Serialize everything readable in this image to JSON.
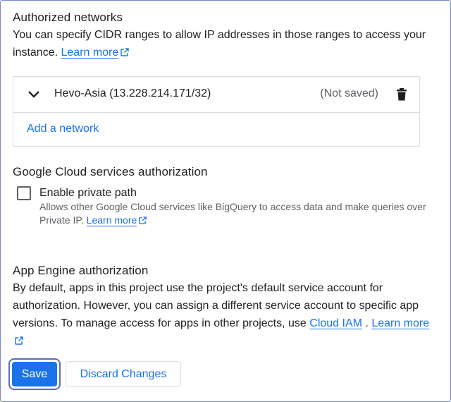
{
  "authorized_networks": {
    "title": "Authorized networks",
    "description": "You can specify CIDR ranges to allow IP addresses in those ranges to access your instance.",
    "learn_more": "Learn more",
    "networks": [
      {
        "name": "Hevo-Asia (13.228.214.171/32)",
        "status": "(Not saved)"
      }
    ],
    "add_network_label": "Add a network"
  },
  "gcs_authorization": {
    "title": "Google Cloud services authorization",
    "checkbox_label": "Enable private path",
    "checkbox_checked": false,
    "help_text": "Allows other Google Cloud services like BigQuery to access data and make queries over Private IP.",
    "learn_more": "Learn more"
  },
  "app_engine": {
    "title": "App Engine authorization",
    "description": "By default, apps in this project use the project's default service account for authorization. However, you can assign a different service account to specific app versions. To manage access for apps in other projects, use",
    "cloud_iam_link": "Cloud IAM",
    "separator": ".",
    "learn_more": "Learn more"
  },
  "actions": {
    "save_label": "Save",
    "discard_label": "Discard Changes"
  },
  "colors": {
    "accent": "#1a73e8",
    "focus_ring": "#5c6bc0",
    "border": "#dadce0",
    "secondary_text": "#5f6368"
  },
  "icons": {
    "external_link": "external-link-icon",
    "expand": "chevron-down-icon",
    "delete": "trash-icon"
  }
}
